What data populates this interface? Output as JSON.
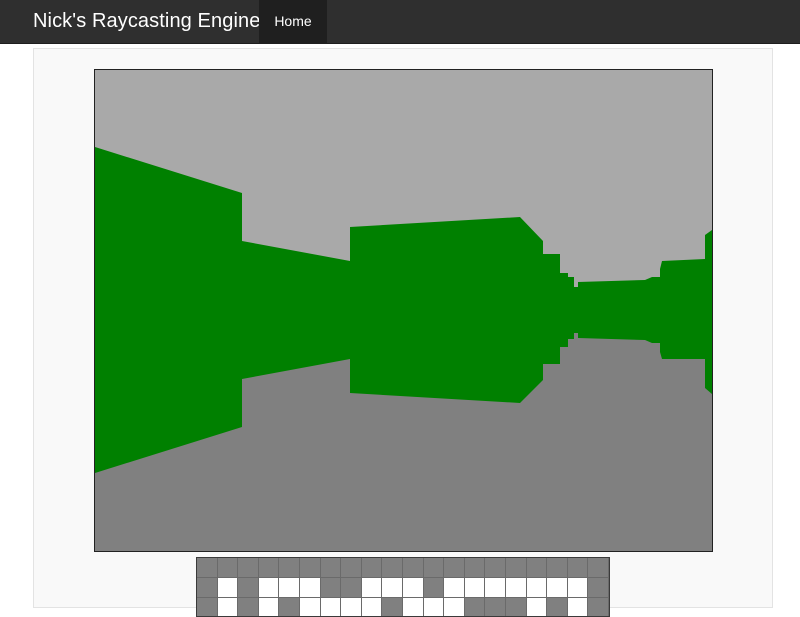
{
  "navbar": {
    "brand": "Nick's Raycasting Engine",
    "home_label": "Home"
  },
  "colors": {
    "navbar_bg": "#2f2f2f",
    "nav_active_bg": "#1f1f1f",
    "ceiling": "#a9a9a9",
    "floor": "#808080",
    "wall": "#008000",
    "minimap_wall": "#808080",
    "minimap_open": "#ffffff"
  },
  "minimap": {
    "rows": [
      [
        1,
        1,
        1,
        1,
        1,
        1,
        1,
        1,
        1,
        1,
        1,
        1,
        1,
        1,
        1,
        1,
        1,
        1,
        1,
        1
      ],
      [
        1,
        0,
        1,
        0,
        0,
        0,
        1,
        1,
        0,
        0,
        0,
        1,
        0,
        0,
        0,
        0,
        0,
        0,
        0,
        1
      ],
      [
        1,
        0,
        1,
        0,
        1,
        0,
        0,
        0,
        0,
        1,
        0,
        0,
        0,
        1,
        1,
        1,
        0,
        1,
        0,
        1
      ]
    ]
  }
}
